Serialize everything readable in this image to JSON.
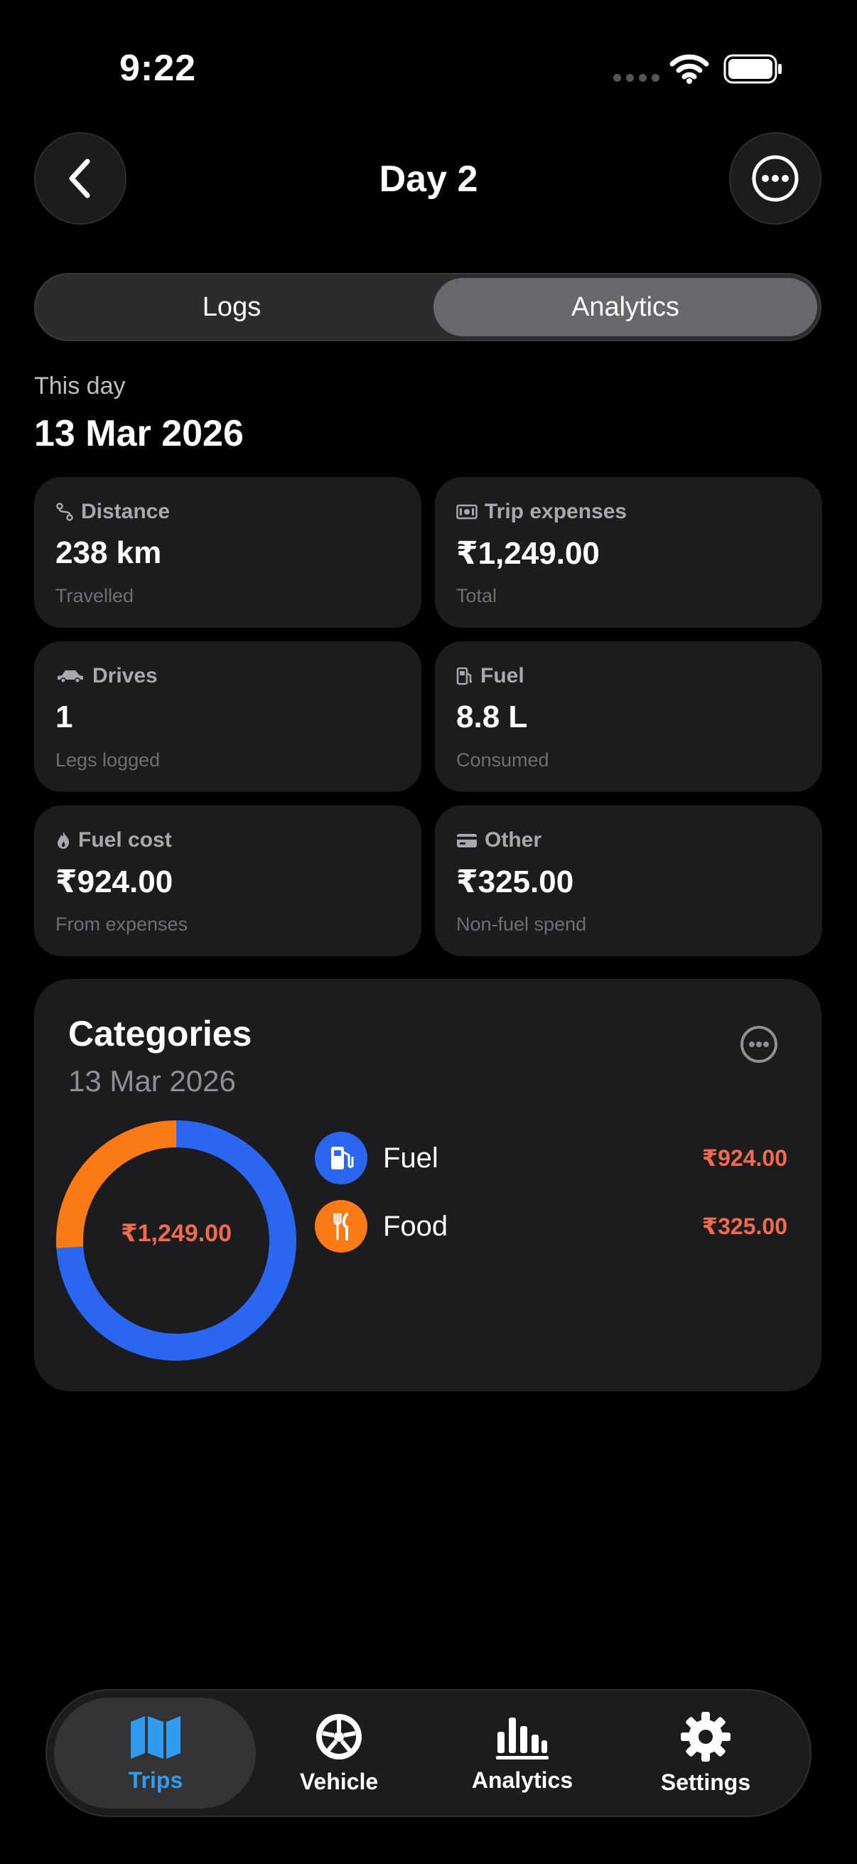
{
  "status_bar": {
    "time": "9:22"
  },
  "header": {
    "title": "Day 2"
  },
  "segments": [
    {
      "label": "Logs"
    },
    {
      "label": "Analytics"
    }
  ],
  "day": {
    "label": "This day",
    "date": "13 Mar 2026"
  },
  "stats": [
    {
      "title": "Distance",
      "value": "238 km",
      "subtitle": "Travelled",
      "icon": "route-icon"
    },
    {
      "title": "Trip expenses",
      "value": "₹1,249.00",
      "subtitle": "Total",
      "icon": "banknote-icon"
    },
    {
      "title": "Drives",
      "value": "1",
      "subtitle": "Legs logged",
      "icon": "car-icon"
    },
    {
      "title": "Fuel",
      "value": "8.8 L",
      "subtitle": "Consumed",
      "icon": "fuel-pump-icon"
    },
    {
      "title": "Fuel cost",
      "value": "₹924.00",
      "subtitle": "From expenses",
      "icon": "flame-icon"
    },
    {
      "title": "Other",
      "value": "₹325.00",
      "subtitle": "Non-fuel spend",
      "icon": "credit-card-icon"
    }
  ],
  "categories": {
    "title": "Categories",
    "date": "13 Mar 2026",
    "total": "₹1,249.00",
    "items": [
      {
        "label": "Fuel",
        "amount": "₹924.00",
        "value": 924,
        "color": "#2a66f0",
        "icon": "fuel-pump-icon"
      },
      {
        "label": "Food",
        "amount": "₹325.00",
        "value": 325,
        "color": "#f97a17",
        "icon": "fork-knife-icon"
      }
    ]
  },
  "tabs": [
    {
      "label": "Trips",
      "icon": "map-icon",
      "active": true
    },
    {
      "label": "Vehicle",
      "icon": "wheel-icon",
      "active": false
    },
    {
      "label": "Analytics",
      "icon": "bar-chart-icon",
      "active": false
    },
    {
      "label": "Settings",
      "icon": "gear-icon",
      "active": false
    }
  ],
  "colors": {
    "accent": "#2f9cf0",
    "amount": "#f06a4e",
    "card": "#1c1c1e"
  }
}
